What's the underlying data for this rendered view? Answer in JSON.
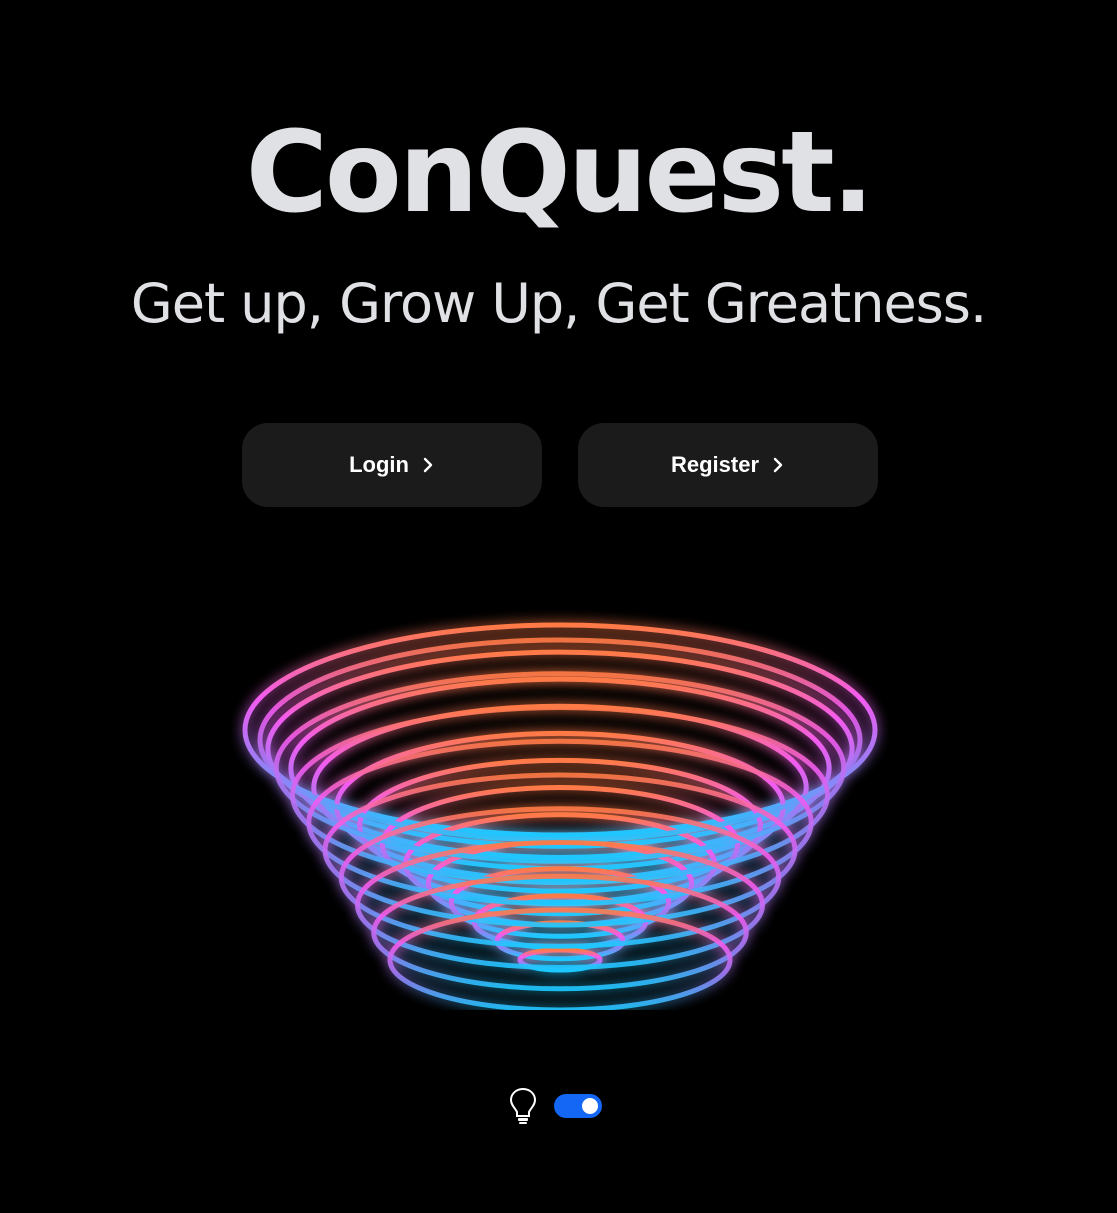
{
  "hero": {
    "title": "ConQuest.",
    "tagline": "Get up, Grow Up, Get Greatness."
  },
  "actions": {
    "login_label": "Login",
    "register_label": "Register"
  },
  "icons": {
    "login_chevron": "chevron-right-icon",
    "register_chevron": "chevron-right-icon",
    "theme": "lightbulb-icon"
  },
  "theme_toggle": {
    "on": true,
    "color": "#1466f5"
  },
  "colors": {
    "background": "#000000",
    "text": "#dfe1e5",
    "button_bg": "#1b1b1b",
    "vortex_top": "#ff7a45",
    "vortex_mid": "#f25bf0",
    "vortex_bottom": "#1ec8ff"
  }
}
